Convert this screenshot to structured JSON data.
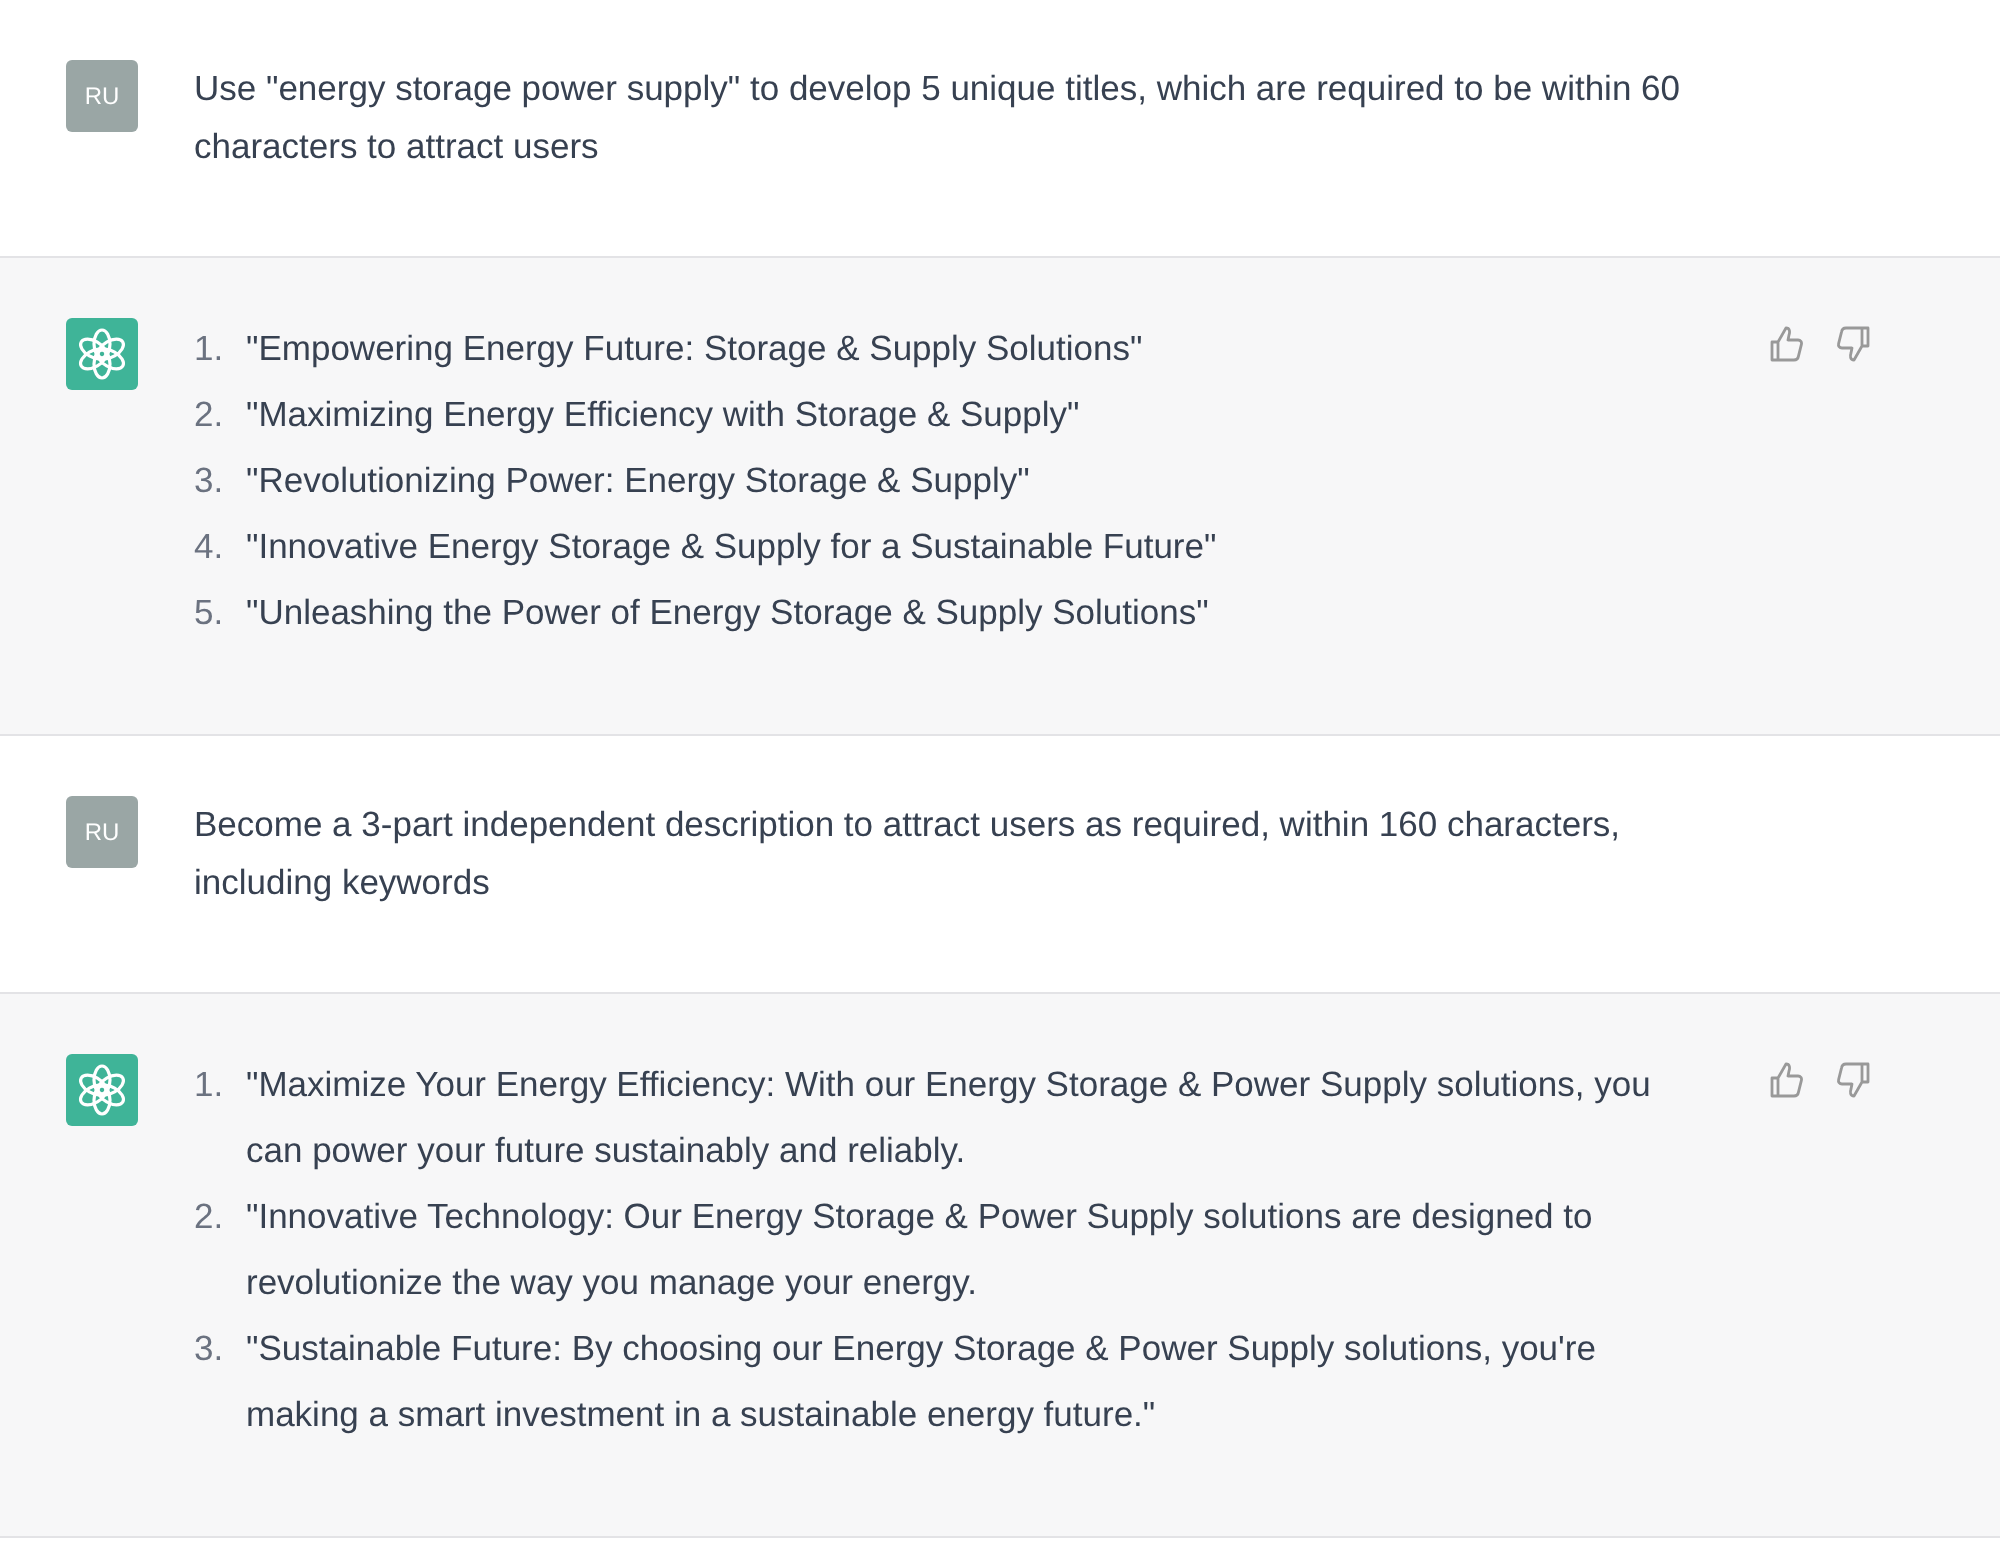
{
  "messages": [
    {
      "kind": "user",
      "avatar": "RU",
      "text": "Use \"energy storage power supply\" to develop 5 unique titles, which are required to be within 60 characters to attract users"
    },
    {
      "kind": "assistant",
      "items": [
        {
          "number": "1.",
          "text": "\"Empowering Energy Future: Storage & Supply Solutions\""
        },
        {
          "number": "2.",
          "text": "\"Maximizing Energy Efficiency with Storage & Supply\""
        },
        {
          "number": "3.",
          "text": "\"Revolutionizing Power: Energy Storage & Supply\""
        },
        {
          "number": "4.",
          "text": "\"Innovative Energy Storage & Supply for a Sustainable Future\""
        },
        {
          "number": "5.",
          "text": "\"Unleashing the Power of Energy Storage & Supply Solutions\""
        }
      ]
    },
    {
      "kind": "user",
      "avatar": "RU",
      "text": "Become a 3-part independent description to attract users as required, within 160 characters, including keywords"
    },
    {
      "kind": "assistant",
      "items": [
        {
          "number": "1.",
          "text": "\"Maximize Your Energy Efficiency: With our Energy Storage & Power Supply solutions, you can power your future sustainably and reliably."
        },
        {
          "number": "2.",
          "text": "\"Innovative Technology: Our Energy Storage & Power Supply solutions are designed to revolutionize the way you manage your energy."
        },
        {
          "number": "3.",
          "text": "\"Sustainable Future: By choosing our Energy Storage & Power Supply solutions, you're making a smart investment in a sustainable energy future.\""
        }
      ]
    }
  ]
}
